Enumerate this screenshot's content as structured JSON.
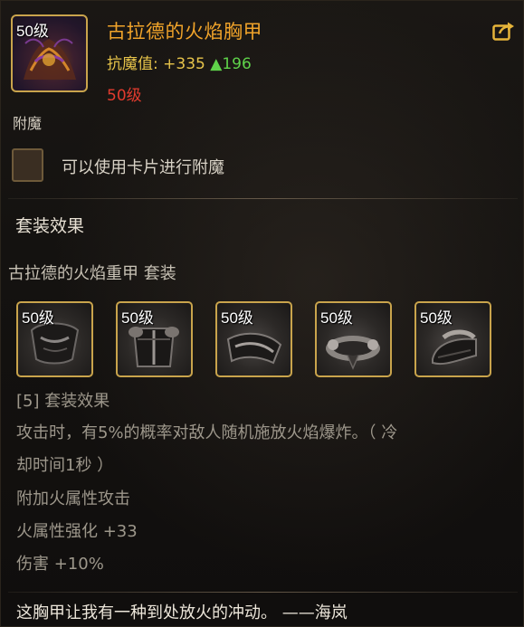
{
  "item": {
    "level_badge": "50级",
    "name": "古拉德的火焰胸甲",
    "resist_label": "抗魔值:",
    "resist_value": "+335",
    "resist_bonus": "▲196",
    "required_level": "50级"
  },
  "enchant": {
    "label": "附魔",
    "card_hint": "可以使用卡片进行附魔"
  },
  "set": {
    "header": "套装效果",
    "name": "古拉德的火焰重甲  套装",
    "pieces": [
      {
        "level_badge": "50级"
      },
      {
        "level_badge": "50级"
      },
      {
        "level_badge": "50级"
      },
      {
        "level_badge": "50级"
      },
      {
        "level_badge": "50级"
      }
    ],
    "bonus_lines": [
      "[5] 套装效果",
      "攻击时，有5%的概率对敌人随机施放火焰爆炸。（ 冷",
      "却时间1秒 ）",
      "附加火属性攻击",
      "火属性强化 +33",
      "伤害 +10%"
    ]
  },
  "flavor_text": "这胸甲让我有一种到处放火的冲动。 ——海岚",
  "colors": {
    "item_name": "#f0a32a",
    "resist": "#e6c34a",
    "resist_up": "#5fd34a",
    "required_level": "#e23b2e",
    "frame_gold": "#c9a44c"
  },
  "icons": [
    "share-icon",
    "chest-armor-icon",
    "set-piece-icon"
  ]
}
